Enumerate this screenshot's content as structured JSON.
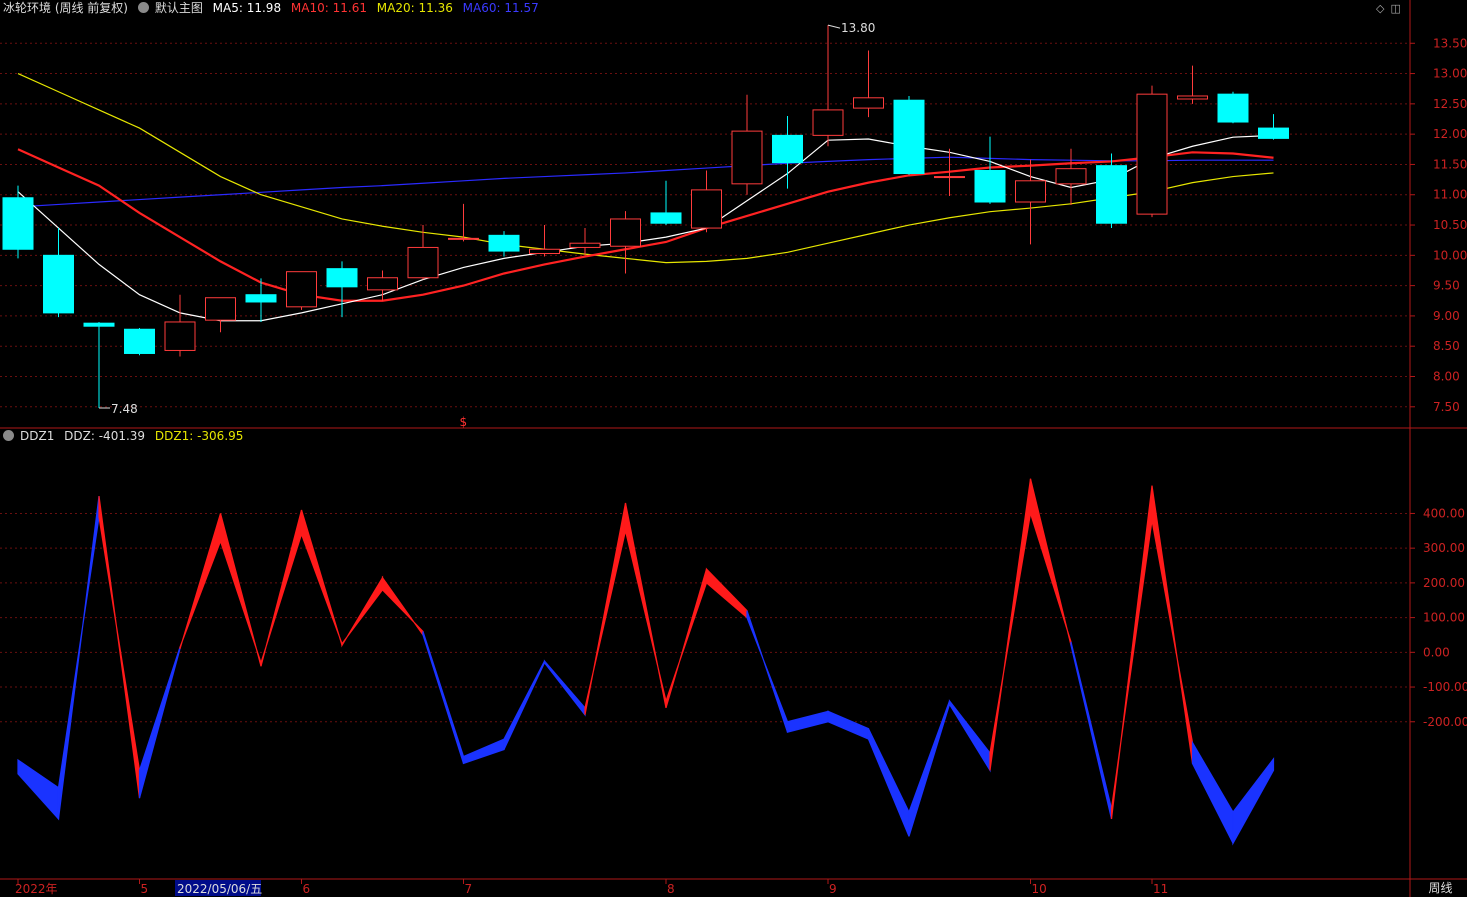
{
  "header": {
    "stock_name": "冰轮环境 (周线 前复权)",
    "template": "默认主图",
    "ma5": "MA5: 11.98",
    "ma10": "MA10: 11.61",
    "ma20": "MA20: 11.36",
    "ma60": "MA60: 11.57"
  },
  "indicator_header": {
    "name": "DDZ1",
    "ddz": "DDZ: -401.39",
    "ddz1": "DDZ1: -306.95"
  },
  "period_button": "周线",
  "colors": {
    "up": "#ff3c3c",
    "down": "#00ffff",
    "ma5": "#ffffff",
    "ma10": "#ff2222",
    "ma20": "#e6e600",
    "ma60": "#2a2aff",
    "axis": "#b01818",
    "grid": "#6a0f0f"
  },
  "chart_data": [
    {
      "type": "candlestick",
      "title": "冰轮环境 (周线 前复权)",
      "y_ticks": [
        7.5,
        8.0,
        8.5,
        9.0,
        9.5,
        10.0,
        10.5,
        11.0,
        11.5,
        12.0,
        12.5,
        13.0,
        13.5
      ],
      "ylim": [
        7.15,
        13.95
      ],
      "annotations": [
        {
          "label": "13.80",
          "candle_index": 20
        },
        {
          "label": "7.48",
          "candle_index": 2
        },
        {
          "label": "$",
          "candle_index": 11
        }
      ],
      "candles": [
        {
          "o": 10.95,
          "h": 11.15,
          "l": 9.95,
          "c": 10.1
        },
        {
          "o": 10.0,
          "h": 10.45,
          "l": 8.98,
          "c": 9.05
        },
        {
          "o": 8.88,
          "h": 8.9,
          "l": 7.48,
          "c": 8.83
        },
        {
          "o": 8.78,
          "h": 8.8,
          "l": 8.35,
          "c": 8.38
        },
        {
          "o": 8.43,
          "h": 9.35,
          "l": 8.33,
          "c": 8.9
        },
        {
          "o": 8.93,
          "h": 9.3,
          "l": 8.73,
          "c": 9.3
        },
        {
          "o": 9.35,
          "h": 9.62,
          "l": 8.9,
          "c": 9.23
        },
        {
          "o": 9.15,
          "h": 9.73,
          "l": 9.1,
          "c": 9.73
        },
        {
          "o": 9.78,
          "h": 9.9,
          "l": 8.98,
          "c": 9.48
        },
        {
          "o": 9.43,
          "h": 9.75,
          "l": 9.25,
          "c": 9.63
        },
        {
          "o": 9.63,
          "h": 10.5,
          "l": 9.6,
          "c": 10.13
        },
        {
          "o": 10.28,
          "h": 10.85,
          "l": 10.23,
          "c": 10.28
        },
        {
          "o": 10.33,
          "h": 10.4,
          "l": 9.98,
          "c": 10.07
        },
        {
          "o": 10.03,
          "h": 10.5,
          "l": 9.98,
          "c": 10.1
        },
        {
          "o": 10.13,
          "h": 10.45,
          "l": 10.0,
          "c": 10.2
        },
        {
          "o": 10.15,
          "h": 10.73,
          "l": 9.7,
          "c": 10.6
        },
        {
          "o": 10.7,
          "h": 11.23,
          "l": 10.5,
          "c": 10.53
        },
        {
          "o": 10.45,
          "h": 11.4,
          "l": 10.38,
          "c": 11.08
        },
        {
          "o": 11.18,
          "h": 12.65,
          "l": 11.0,
          "c": 12.05
        },
        {
          "o": 11.98,
          "h": 12.3,
          "l": 11.1,
          "c": 11.53
        },
        {
          "o": 11.98,
          "h": 13.8,
          "l": 11.8,
          "c": 12.4
        },
        {
          "o": 12.43,
          "h": 13.38,
          "l": 12.28,
          "c": 12.6
        },
        {
          "o": 12.56,
          "h": 12.63,
          "l": 11.33,
          "c": 11.35
        },
        {
          "o": 11.3,
          "h": 11.76,
          "l": 10.98,
          "c": 11.3
        },
        {
          "o": 11.4,
          "h": 11.96,
          "l": 10.85,
          "c": 10.88
        },
        {
          "o": 10.88,
          "h": 11.58,
          "l": 10.18,
          "c": 11.23
        },
        {
          "o": 11.18,
          "h": 11.76,
          "l": 10.83,
          "c": 11.43
        },
        {
          "o": 11.48,
          "h": 11.68,
          "l": 10.45,
          "c": 10.53
        },
        {
          "o": 10.68,
          "h": 12.8,
          "l": 10.63,
          "c": 12.66
        },
        {
          "o": 12.58,
          "h": 13.13,
          "l": 12.5,
          "c": 12.63
        },
        {
          "o": 12.66,
          "h": 12.7,
          "l": 12.18,
          "c": 12.2
        },
        {
          "o": 12.1,
          "h": 12.33,
          "l": 11.91,
          "c": 11.93
        }
      ],
      "ma5": [
        11.05,
        10.45,
        9.85,
        9.35,
        9.05,
        8.92,
        8.92,
        9.05,
        9.2,
        9.35,
        9.6,
        9.8,
        9.95,
        10.05,
        10.15,
        10.2,
        10.3,
        10.45,
        10.9,
        11.35,
        11.9,
        11.92,
        11.8,
        11.7,
        11.55,
        11.3,
        11.12,
        11.25,
        11.6,
        11.8,
        11.95,
        11.98
      ],
      "ma10": [
        11.75,
        11.45,
        11.15,
        10.7,
        10.3,
        9.9,
        9.55,
        9.35,
        9.25,
        9.25,
        9.35,
        9.5,
        9.7,
        9.85,
        9.98,
        10.1,
        10.22,
        10.45,
        10.65,
        10.85,
        11.05,
        11.2,
        11.32,
        11.38,
        11.45,
        11.48,
        11.52,
        11.55,
        11.62,
        11.7,
        11.68,
        11.61
      ],
      "ma20": [
        13.0,
        12.7,
        12.4,
        12.1,
        11.7,
        11.3,
        11.0,
        10.8,
        10.6,
        10.48,
        10.38,
        10.3,
        10.18,
        10.1,
        10.02,
        9.95,
        9.88,
        9.9,
        9.95,
        10.05,
        10.2,
        10.35,
        10.5,
        10.62,
        10.72,
        10.78,
        10.85,
        10.95,
        11.05,
        11.2,
        11.3,
        11.36
      ],
      "ma60": [
        10.8,
        10.84,
        10.88,
        10.92,
        10.96,
        11.0,
        11.04,
        11.08,
        11.12,
        11.15,
        11.19,
        11.23,
        11.27,
        11.3,
        11.33,
        11.36,
        11.4,
        11.44,
        11.48,
        11.52,
        11.55,
        11.58,
        11.6,
        11.62,
        11.6,
        11.58,
        11.57,
        11.56,
        11.56,
        11.57,
        11.57,
        11.57
      ]
    },
    {
      "type": "area",
      "title": "DDZ1",
      "series": [
        {
          "name": "DDZ",
          "values": [
            -350,
            -480,
            450,
            -420,
            10,
            400,
            -40,
            410,
            20,
            215,
            50,
            -320,
            -280,
            -30,
            -180,
            430,
            -160,
            240,
            120,
            -230,
            -200,
            -250,
            -530,
            -150,
            -340,
            500,
            20,
            -480,
            480,
            -320,
            -550,
            -340
          ]
        },
        {
          "name": "DDZ1",
          "values": [
            -310,
            -390,
            390,
            -340,
            15,
            320,
            -30,
            340,
            25,
            180,
            60,
            -300,
            -250,
            -25,
            -160,
            350,
            -140,
            200,
            100,
            -200,
            -170,
            -220,
            -460,
            -140,
            -290,
            400,
            30,
            -450,
            380,
            -260,
            -460,
            -307
          ]
        }
      ],
      "y_ticks": [
        -200,
        -100,
        0,
        100,
        200,
        300,
        400
      ],
      "ylim": [
        -650,
        600
      ]
    }
  ],
  "x_axis": [
    {
      "label": "2022年",
      "candle_index": 0
    },
    {
      "label": "5",
      "candle_index": 3
    },
    {
      "label": "2022/05/06/五",
      "candle_index": 4
    },
    {
      "label": "6",
      "candle_index": 7
    },
    {
      "label": "7",
      "candle_index": 11
    },
    {
      "label": "8",
      "candle_index": 16
    },
    {
      "label": "9",
      "candle_index": 20
    },
    {
      "label": "10",
      "candle_index": 25
    },
    {
      "label": "11",
      "candle_index": 28
    }
  ]
}
